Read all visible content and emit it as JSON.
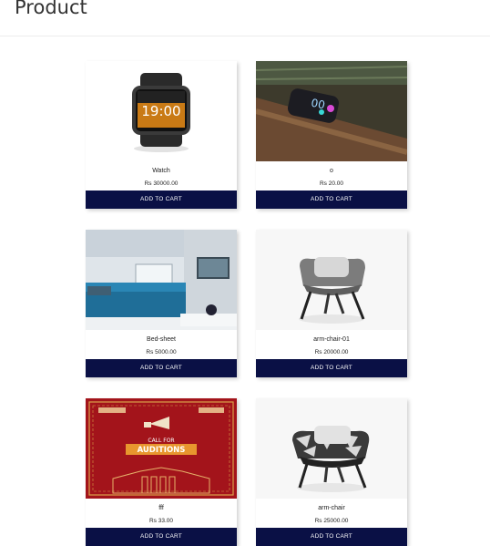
{
  "page": {
    "title": "Product"
  },
  "products": [
    {
      "name": "Watch",
      "price": "Rs 30000.00",
      "button": "ADD TO CART",
      "watch_time": "19:00"
    },
    {
      "name": "o",
      "price": "Rs 20.00",
      "button": "ADD TO CART"
    },
    {
      "name": "Bed-sheet",
      "price": "Rs 5000.00",
      "button": "ADD TO CART"
    },
    {
      "name": "arm-chair-01",
      "price": "Rs 20000.00",
      "button": "ADD TO CART"
    },
    {
      "name": "fff",
      "price": "Rs 33.00",
      "button": "ADD TO CART",
      "poster_line1": "CALL FOR",
      "poster_line2": "AUDITIONS"
    },
    {
      "name": "arm-chair",
      "price": "Rs 25000.00",
      "button": "ADD TO CART"
    }
  ]
}
